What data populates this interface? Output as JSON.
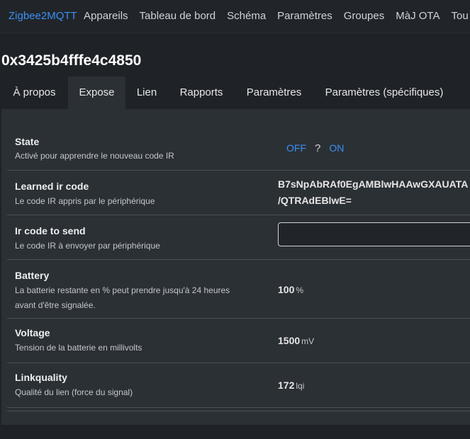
{
  "navbar": {
    "brand": "Zigbee2MQTT",
    "links": [
      "Appareils",
      "Tableau de bord",
      "Schéma",
      "Paramètres",
      "Groupes",
      "MàJ OTA",
      "Tou"
    ]
  },
  "device": {
    "title": "0x3425b4fffe4c4850"
  },
  "tabs": [
    "À propos",
    "Expose",
    "Lien",
    "Rapports",
    "Paramètres",
    "Paramètres (spécifiques)"
  ],
  "active_tab": "Expose",
  "rows": {
    "state": {
      "label": "State",
      "desc": "Activé pour apprendre le nouveau code IR",
      "off": "OFF",
      "sep": "?",
      "on": "ON"
    },
    "learned": {
      "label": "Learned ir code",
      "desc": "Le code IR appris par le périphérique",
      "value_line1": "B7sNpAbRAf0EgAMBlwHAAwGXAUATA",
      "value_line2": "/QTRAdEBlwE="
    },
    "ir_send": {
      "label": "Ir code to send",
      "desc": "Le code IR à envoyer par périphérique",
      "value": ""
    },
    "battery": {
      "label": "Battery",
      "desc1": "La batterie restante en % peut prendre jusqu'à 24 heures",
      "desc2": "avant d'être signalée.",
      "value": "100",
      "unit": "%"
    },
    "voltage": {
      "label": "Voltage",
      "desc": "Tension de la batterie en millivolts",
      "value": "1500",
      "unit": "mV"
    },
    "linkquality": {
      "label": "Linkquality",
      "desc": "Qualité du lien (force du signal)",
      "value": "172",
      "unit": "lqi"
    }
  },
  "colors": {
    "accent": "#3b8ff5",
    "background": "#1f2327",
    "panel": "#2b3035"
  }
}
